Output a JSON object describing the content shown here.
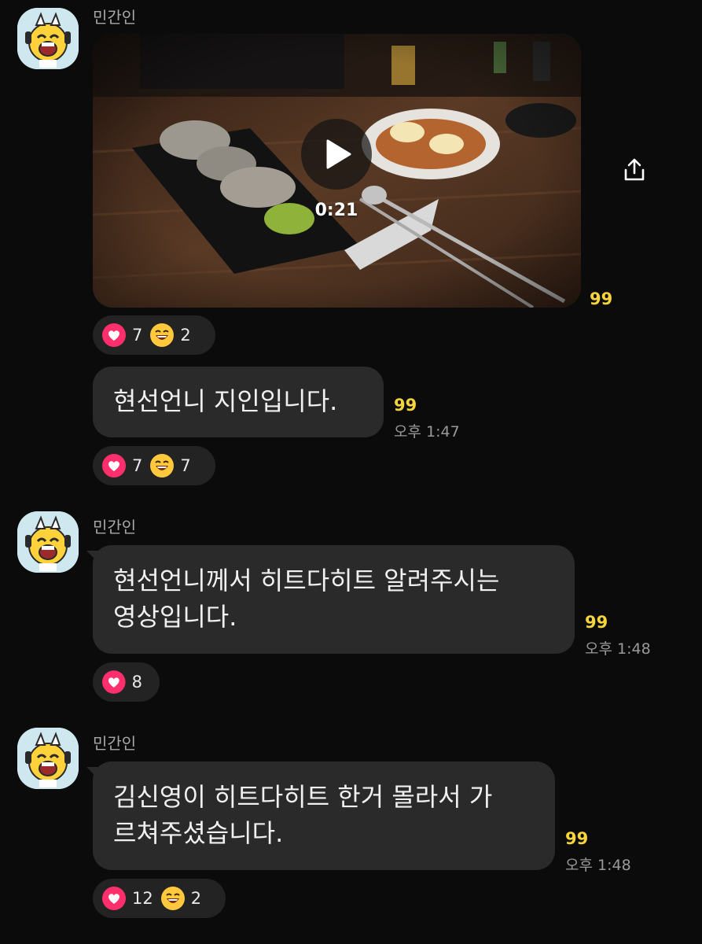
{
  "messages": [
    {
      "sender": "민간인",
      "video": {
        "duration": "0:21"
      },
      "unread": "99",
      "reactions": [
        {
          "icon": "heart-icon",
          "count": "7"
        },
        {
          "icon": "laughing-face-icon",
          "count": "2"
        }
      ]
    },
    {
      "text": "현선언니 지인입니다.",
      "unread": "99",
      "time": "오후 1:47",
      "reactions": [
        {
          "icon": "heart-icon",
          "count": "7"
        },
        {
          "icon": "laughing-face-icon",
          "count": "7"
        }
      ]
    },
    {
      "sender": "민간인",
      "text_lines": [
        "현선언니께서 히트다히트 알려주시는",
        "영상입니다."
      ],
      "unread": "99",
      "time": "오후 1:48",
      "reactions": [
        {
          "icon": "heart-icon",
          "count": "8"
        }
      ]
    },
    {
      "sender": "민간인",
      "text_lines": [
        "김신영이 히트다히트 한거 몰라서 가",
        "르쳐주셨습니다."
      ],
      "unread": "99",
      "time": "오후 1:48",
      "reactions": [
        {
          "icon": "heart-icon",
          "count": "12"
        },
        {
          "icon": "laughing-face-icon",
          "count": "2"
        }
      ]
    }
  ],
  "colors": {
    "background": "#0b0b0b",
    "bubble": "#2a2a2a",
    "unread": "#f6d43b",
    "heart": "#ff2f6d",
    "emoji": "#ffc83d"
  }
}
